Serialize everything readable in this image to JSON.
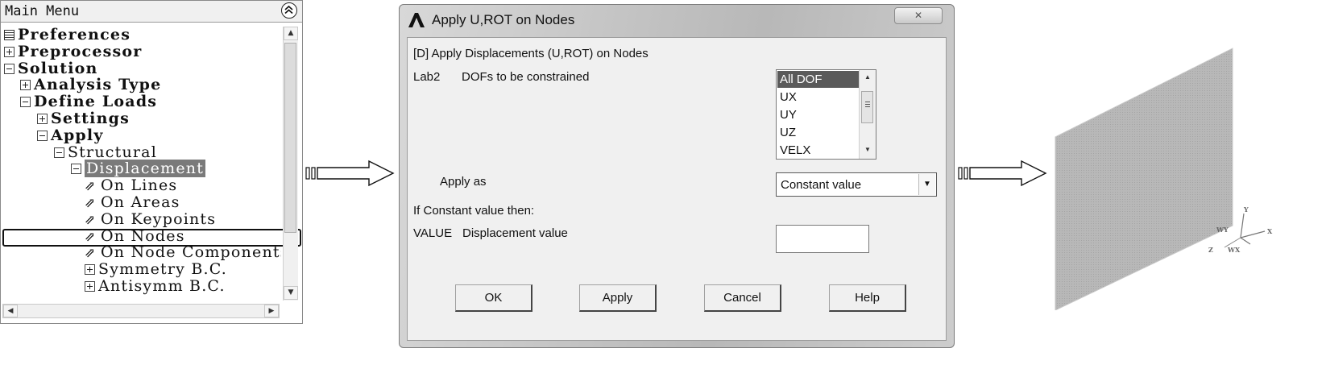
{
  "menu": {
    "title": "Main Menu",
    "items": [
      {
        "label": "Preferences",
        "level": 0,
        "glyph": "doc",
        "bold": true
      },
      {
        "label": "Preprocessor",
        "level": 0,
        "glyph": "plus",
        "bold": true
      },
      {
        "label": "Solution",
        "level": 0,
        "glyph": "minus",
        "bold": true
      },
      {
        "label": "Analysis Type",
        "level": 1,
        "glyph": "plus",
        "bold": true
      },
      {
        "label": "Define Loads",
        "level": 1,
        "glyph": "minus",
        "bold": true
      },
      {
        "label": "Settings",
        "level": 2,
        "glyph": "plus",
        "bold": true
      },
      {
        "label": "Apply",
        "level": 2,
        "glyph": "minus",
        "bold": true
      },
      {
        "label": "Structural",
        "level": 3,
        "glyph": "minus",
        "bold": false
      },
      {
        "label": "Displacement",
        "level": 4,
        "glyph": "minus",
        "bold": false,
        "selected": true
      },
      {
        "label": "On Lines",
        "level": 5,
        "glyph": "arrow",
        "bold": false
      },
      {
        "label": "On Areas",
        "level": 5,
        "glyph": "arrow",
        "bold": false
      },
      {
        "label": "On Keypoints",
        "level": 5,
        "glyph": "arrow",
        "bold": false
      },
      {
        "label": "On Nodes",
        "level": 5,
        "glyph": "arrow",
        "bold": false,
        "highlighted": true
      },
      {
        "label": "On Node Components",
        "level": 5,
        "glyph": "arrow",
        "bold": false
      },
      {
        "label": "Symmetry B.C.",
        "level": 5,
        "glyph": "plus",
        "bold": false
      },
      {
        "label": "Antisymm B.C.",
        "level": 5,
        "glyph": "plus",
        "bold": false
      }
    ]
  },
  "dialog": {
    "title": "Apply U,ROT on Nodes",
    "header": "[D]  Apply Displacements (U,ROT) on Nodes",
    "lab2_key": "Lab2",
    "lab2_desc": "DOFs to be constrained",
    "dof_options": [
      "All DOF",
      "UX",
      "UY",
      "UZ",
      "VELX"
    ],
    "dof_selected": "All DOF",
    "apply_as_label": "Apply as",
    "apply_as_value": "Constant value",
    "if_constant": "If Constant value then:",
    "value_key": "VALUE",
    "value_desc": "Displacement value",
    "value_input": "",
    "buttons": {
      "ok": "OK",
      "apply": "Apply",
      "cancel": "Cancel",
      "help": "Help"
    }
  },
  "triad": {
    "x": "X",
    "y": "Y",
    "wy": "WY",
    "wx": "WX",
    "z": "Z"
  },
  "colors": {
    "plate": "#b5b5b5",
    "selection": "#7a7a7a",
    "dialog_bg": "#f0f0f0"
  },
  "icons": [
    "collapse-icon",
    "doc-icon",
    "expand-icon",
    "collapse-node-icon",
    "pick-arrow-icon",
    "app-logo-icon",
    "close-icon",
    "dropdown-arrow-icon"
  ]
}
